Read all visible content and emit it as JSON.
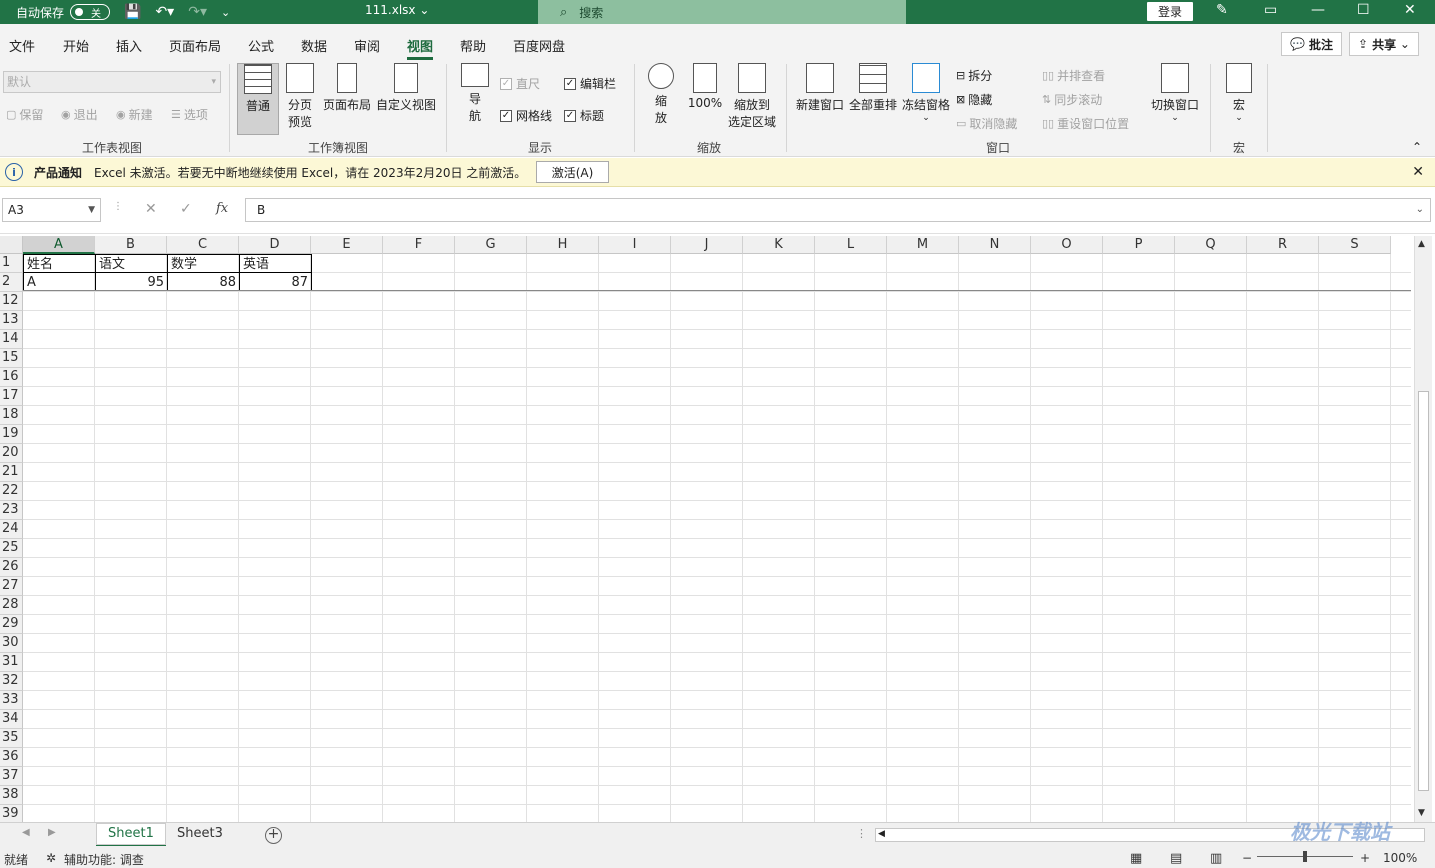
{
  "titlebar": {
    "autosave_label": "自动保存",
    "autosave_state": "关",
    "filename": "111.xlsx",
    "search_placeholder": "搜索",
    "login": "登录"
  },
  "ribbon_tabs": [
    "文件",
    "开始",
    "插入",
    "页面布局",
    "公式",
    "数据",
    "审阅",
    "视图",
    "帮助",
    "百度网盘"
  ],
  "active_tab": "视图",
  "comments_label": "批注",
  "share_label": "共享",
  "ribbon": {
    "sheet_view": {
      "select_value": "默认",
      "keep": "保留",
      "exit": "退出",
      "new": "新建",
      "options": "选项",
      "label": "工作表视图"
    },
    "workbook_views": {
      "normal": "普通",
      "page_break_1": "分页",
      "page_break_2": "预览",
      "page_layout": "页面布局",
      "custom_views": "自定义视图",
      "label": "工作簿视图"
    },
    "show": {
      "nav_1": "导",
      "nav_2": "航",
      "ruler": "直尺",
      "formula_bar": "编辑栏",
      "gridlines": "网格线",
      "headings": "标题",
      "label": "显示"
    },
    "zoom": {
      "zoom_1": "缩",
      "zoom_2": "放",
      "hundred": "100%",
      "to_sel_1": "缩放到",
      "to_sel_2": "选定区域",
      "label": "缩放"
    },
    "window": {
      "new_window": "新建窗口",
      "arrange_all": "全部重排",
      "freeze": "冻结窗格",
      "split": "拆分",
      "hide": "隐藏",
      "unhide": "取消隐藏",
      "side_by_side": "并排查看",
      "sync_scroll": "同步滚动",
      "reset_pos": "重设窗口位置",
      "switch": "切换窗口",
      "label": "窗口"
    },
    "macros": {
      "macro": "宏",
      "label": "宏"
    }
  },
  "notification": {
    "title": "产品通知",
    "text": "Excel 未激活。若要无中断地继续使用 Excel，请在 2023年2月20日 之前激活。",
    "button": "激活(A)"
  },
  "formula_bar": {
    "name_box": "A3",
    "fx": "fx",
    "content": "B"
  },
  "columns": [
    "A",
    "B",
    "C",
    "D",
    "E",
    "F",
    "G",
    "H",
    "I",
    "J",
    "K",
    "L",
    "M",
    "N",
    "O",
    "P",
    "Q",
    "R",
    "S"
  ],
  "rows": [
    "1",
    "2",
    "12",
    "13",
    "14",
    "15",
    "16",
    "17",
    "18",
    "19",
    "20",
    "21",
    "22",
    "23",
    "24",
    "25",
    "26",
    "27",
    "28",
    "29",
    "30",
    "31",
    "32",
    "33",
    "34",
    "35",
    "36",
    "37",
    "38",
    "39"
  ],
  "cells": {
    "r1": [
      "姓名",
      "语文",
      "数学",
      "英语"
    ],
    "r2": [
      "A",
      "95",
      "88",
      "87"
    ]
  },
  "sheets": [
    "Sheet1",
    "Sheet3"
  ],
  "active_sheet": "Sheet1",
  "status": {
    "ready": "就绪",
    "accessibility": "辅助功能: 调查",
    "zoom": "100%"
  },
  "watermark": "极光下载站"
}
